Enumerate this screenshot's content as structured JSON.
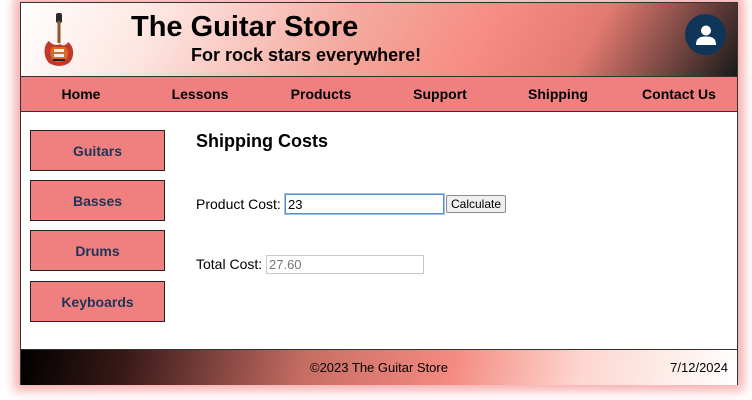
{
  "header": {
    "title": "The Guitar Store",
    "tagline": "For rock stars everywhere!",
    "logo_icon": "electric-guitar-icon",
    "account_icon": "user-avatar-icon"
  },
  "nav": {
    "items": [
      "Home",
      "Lessons",
      "Products",
      "Support",
      "Shipping",
      "Contact Us"
    ]
  },
  "sidebar": {
    "items": [
      "Guitars",
      "Basses",
      "Drums",
      "Keyboards"
    ]
  },
  "main": {
    "heading": "Shipping Costs",
    "product_cost_label": "Product Cost:",
    "product_cost_value": "23",
    "calculate_label": "Calculate",
    "total_cost_label": "Total Cost:",
    "total_cost_value": "27.60"
  },
  "footer": {
    "copyright": "©2023 The Guitar Store",
    "date": "7/12/2024"
  },
  "colors": {
    "accent": "#f08080",
    "nav_text": "#000000",
    "sidebar_text": "#1d3557",
    "avatar_bg": "#0f3558"
  }
}
